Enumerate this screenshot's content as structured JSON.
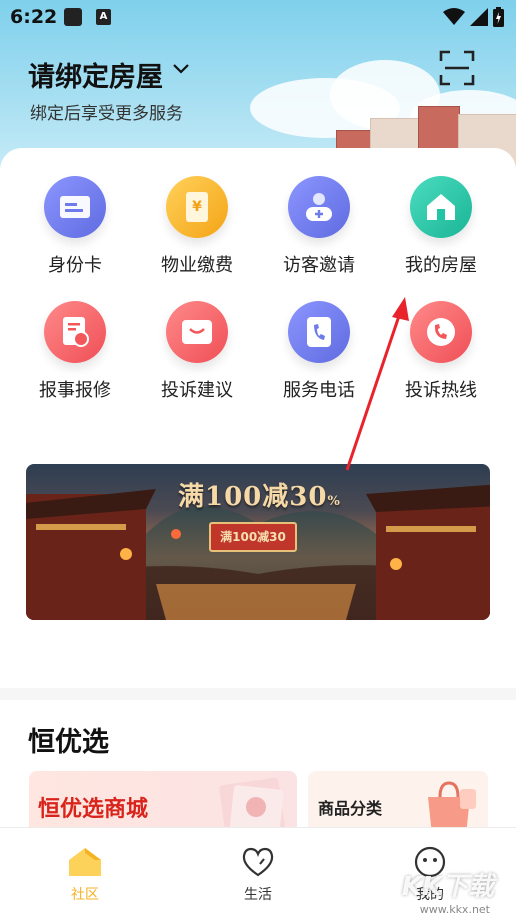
{
  "status_bar": {
    "time": "6:22",
    "app_glyph": "A"
  },
  "header": {
    "title": "请绑定房屋",
    "subtitle": "绑定后享受更多服务",
    "scan_icon": "scan-icon"
  },
  "services": [
    {
      "label": "身份卡",
      "icon": "id-card-icon",
      "color": "#6f7bea"
    },
    {
      "label": "物业缴费",
      "icon": "payment-icon",
      "color": "#fbb52c"
    },
    {
      "label": "访客邀请",
      "icon": "visitor-icon",
      "color": "#6f7bea"
    },
    {
      "label": "我的房屋",
      "icon": "house-icon",
      "color": "#22c4a6"
    },
    {
      "label": "报事报修",
      "icon": "repair-icon",
      "color": "#f2585a"
    },
    {
      "label": "投诉建议",
      "icon": "complaint-icon",
      "color": "#f2585a"
    },
    {
      "label": "服务电话",
      "icon": "phone-icon",
      "color": "#6f7bea"
    },
    {
      "label": "投诉热线",
      "icon": "hotline-icon",
      "color": "#f2585a"
    }
  ],
  "banner": {
    "headline": "满100减30",
    "headline_suffix": "%",
    "sign": "满100减30"
  },
  "section": {
    "title": "恒优选",
    "promo_main": "恒优选商城",
    "promo_secondary": "商品分类"
  },
  "tabs": [
    {
      "label": "社区",
      "active": true,
      "color": "#f5b324"
    },
    {
      "label": "生活",
      "active": false,
      "color": "#333333"
    },
    {
      "label": "我的",
      "active": false,
      "color": "#333333"
    }
  ],
  "watermark": {
    "logo": "KK下载",
    "url": "www.kkx.net"
  }
}
